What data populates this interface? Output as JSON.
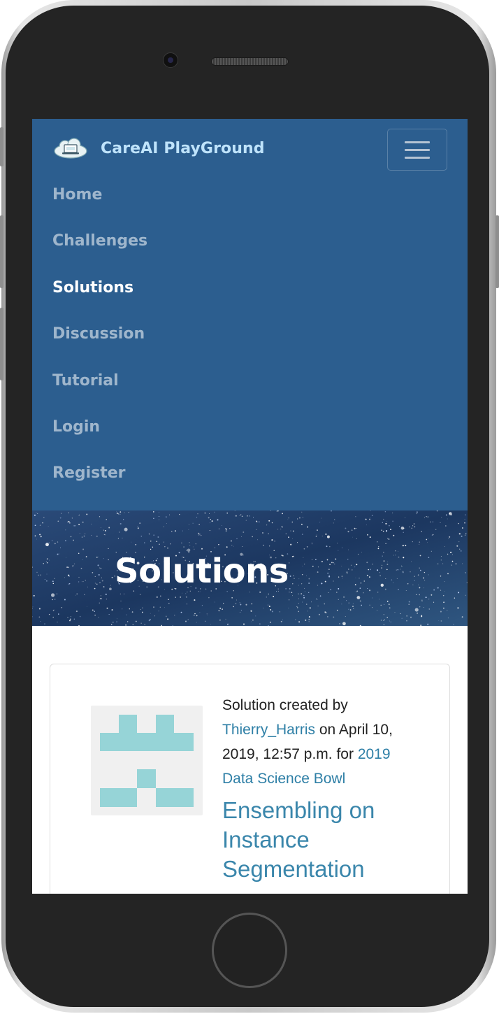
{
  "app": {
    "brand_name": "CareAI PlayGround"
  },
  "nav": {
    "items": [
      {
        "label": "Home",
        "active": false
      },
      {
        "label": "Challenges",
        "active": false
      },
      {
        "label": "Solutions",
        "active": true
      },
      {
        "label": "Discussion",
        "active": false
      },
      {
        "label": "Tutorial",
        "active": false
      },
      {
        "label": "Login",
        "active": false
      },
      {
        "label": "Register",
        "active": false
      }
    ]
  },
  "hero": {
    "title": "Solutions"
  },
  "solution": {
    "prefix": "Solution created by",
    "author": "Thierry_Harris",
    "date_text": "on April 10, 2019, 12:57 p.m. for",
    "challenge": "2019 Data Science Bowl",
    "title": "Ensembling on Instance Segmentation"
  },
  "colors": {
    "navbar_bg": "#2c5e8f",
    "brand_text": "#bfe3fb",
    "link": "#2e7fa6",
    "identicon": "#96d4d7"
  },
  "icons": {
    "logo": "cloud-laptop-icon",
    "menu": "hamburger-menu-icon",
    "avatar": "identicon-avatar"
  }
}
